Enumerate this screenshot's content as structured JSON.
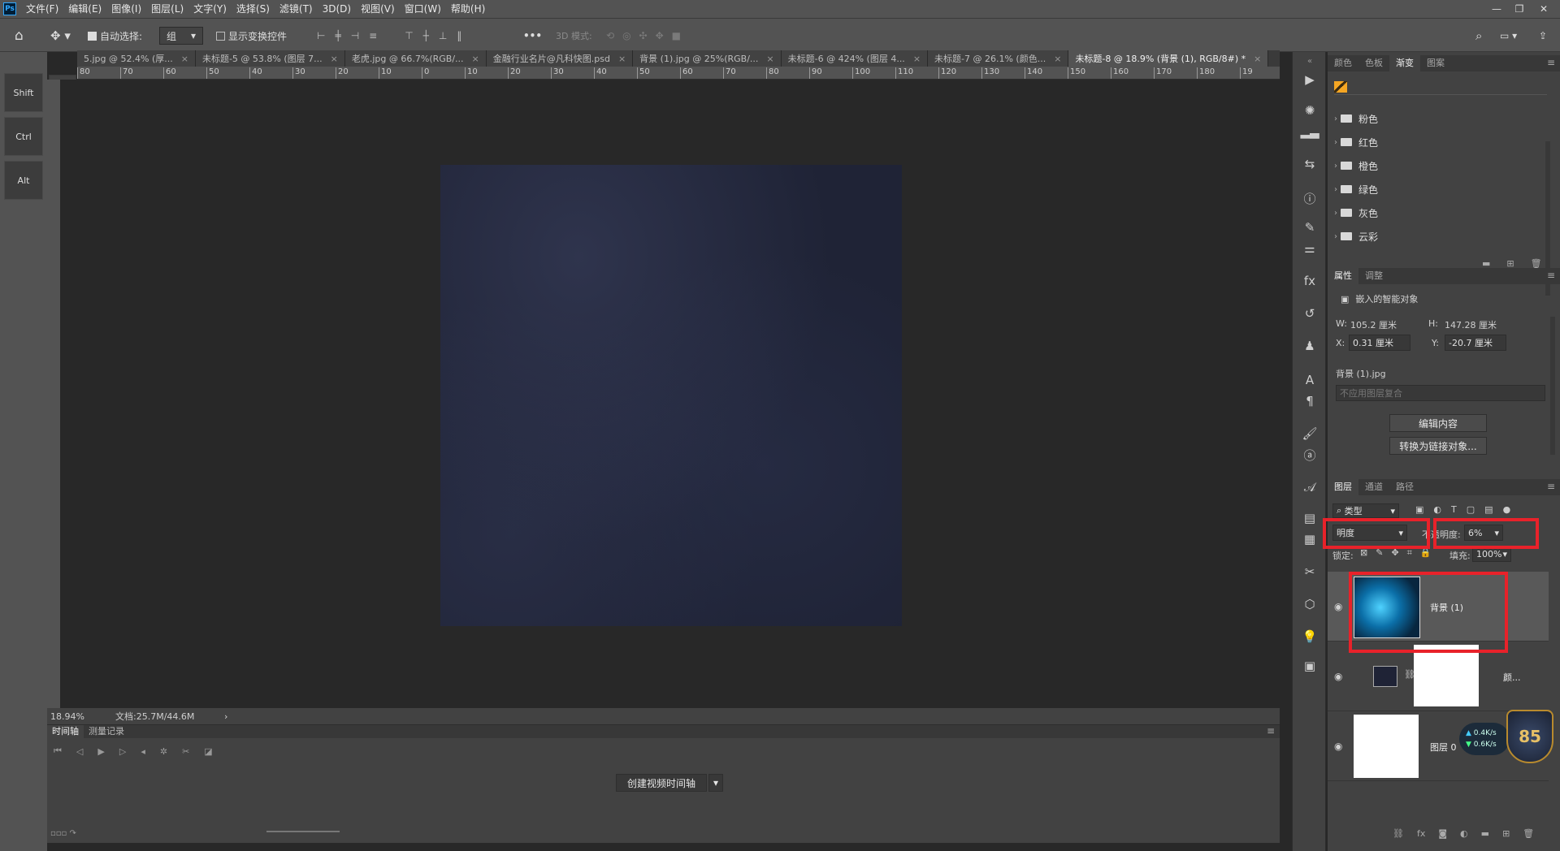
{
  "app": {
    "logo": "Ps"
  },
  "menu": [
    "文件(F)",
    "编辑(E)",
    "图像(I)",
    "图层(L)",
    "文字(Y)",
    "选择(S)",
    "滤镜(T)",
    "3D(D)",
    "视图(V)",
    "窗口(W)",
    "帮助(H)"
  ],
  "options": {
    "auto_select_label": "自动选择:",
    "auto_select_value": "组",
    "show_transform_label": "显示变换控件",
    "mode_3d_label": "3D 模式:",
    "more_label": "•••"
  },
  "modifiers": [
    "Shift",
    "Ctrl",
    "Alt"
  ],
  "tabs": [
    {
      "label": "5.jpg @ 52.4% (厚...",
      "close": "×"
    },
    {
      "label": "未标题-5 @ 53.8% (图层 7...",
      "close": "×"
    },
    {
      "label": "老虎.jpg @ 66.7%(RGB/...",
      "close": "×"
    },
    {
      "label": "金融行业名片@凡科快图.psd",
      "close": "×"
    },
    {
      "label": "背景 (1).jpg @ 25%(RGB/...",
      "close": "×"
    },
    {
      "label": "未标题-6 @ 424% (图层 4...",
      "close": "×"
    },
    {
      "label": "未标题-7 @ 26.1% (颜色...",
      "close": "×"
    },
    {
      "label": "未标题-8 @ 18.9% (背景 (1), RGB/8#) *",
      "close": "×",
      "active": true
    }
  ],
  "ruler_h": [
    "80",
    "70",
    "60",
    "50",
    "40",
    "30",
    "20",
    "10",
    "0",
    "10",
    "20",
    "30",
    "40",
    "50",
    "60",
    "70",
    "80",
    "90",
    "100",
    "110",
    "120",
    "130",
    "140",
    "150",
    "160",
    "170",
    "180",
    "19"
  ],
  "status": {
    "zoom": "18.94%",
    "doc": "文档:25.7M/44.6M",
    "arrow": "›"
  },
  "timeline": {
    "tab1": "时间轴",
    "tab2": "测量记录",
    "create_button": "创建视频时间轴"
  },
  "color_panel": {
    "tabs": [
      "颜色",
      "色板",
      "渐变",
      "图案"
    ],
    "active": "渐变",
    "folders": [
      "粉色",
      "红色",
      "橙色",
      "绿色",
      "灰色",
      "云彩"
    ]
  },
  "properties": {
    "tabs": [
      "属性",
      "调整"
    ],
    "title": "嵌入的智能对象",
    "w_label": "W:",
    "w_value": "105.2 厘米",
    "h_label": "H:",
    "h_value": "147.28 厘米",
    "x_label": "X:",
    "x_value": "0.31 厘米",
    "y_label": "Y:",
    "y_value": "-20.7 厘米",
    "filename": "背景 (1).jpg",
    "comp_placeholder": "不应用图层复合",
    "edit_button": "编辑内容",
    "convert_button": "转换为链接对象..."
  },
  "layers": {
    "tabs": [
      "图层",
      "通道",
      "路径"
    ],
    "filter_label": "类型",
    "blend_mode": "明度",
    "opacity_label": "不透明度:",
    "opacity_value": "6%",
    "lock_label": "锁定:",
    "fill_label": "填充:",
    "fill_value": "100%",
    "rows": [
      {
        "name": "背景 (1)"
      },
      {
        "name": "颜..."
      },
      {
        "name": "图层 0"
      }
    ]
  },
  "widget": {
    "level": "85",
    "up": "0.4K/s",
    "down": "0.6K/s"
  },
  "colors": {
    "highlight": "#e8222a",
    "accent": "#31a8ff"
  }
}
